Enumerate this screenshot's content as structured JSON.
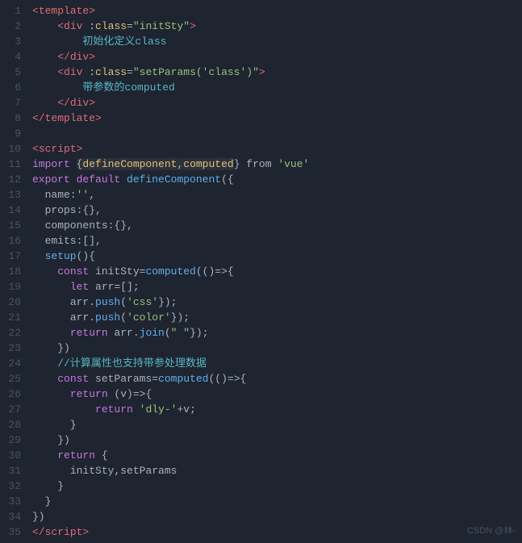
{
  "editor": {
    "lines": [
      {
        "num": 1,
        "tokens": [
          {
            "t": "<",
            "c": "kw-tag"
          },
          {
            "t": "template",
            "c": "kw-tag"
          },
          {
            "t": ">",
            "c": "kw-tag"
          }
        ]
      },
      {
        "num": 2,
        "tokens": [
          {
            "t": "    <",
            "c": "kw-tag"
          },
          {
            "t": "div",
            "c": "kw-tag"
          },
          {
            "t": " ",
            "c": "plain"
          },
          {
            "t": ":class",
            "c": "kw-attr"
          },
          {
            "t": "=",
            "c": "plain"
          },
          {
            "t": "\"initSty\"",
            "c": "kw-attr-val"
          },
          {
            "t": ">",
            "c": "kw-tag"
          }
        ]
      },
      {
        "num": 3,
        "tokens": [
          {
            "t": "        ",
            "c": "plain"
          },
          {
            "t": "初始化定义class",
            "c": "comment-cn"
          }
        ]
      },
      {
        "num": 4,
        "tokens": [
          {
            "t": "    </",
            "c": "kw-tag"
          },
          {
            "t": "div",
            "c": "kw-tag"
          },
          {
            "t": ">",
            "c": "kw-tag"
          }
        ]
      },
      {
        "num": 5,
        "tokens": [
          {
            "t": "    <",
            "c": "kw-tag"
          },
          {
            "t": "div",
            "c": "kw-tag"
          },
          {
            "t": " ",
            "c": "plain"
          },
          {
            "t": ":class",
            "c": "kw-attr"
          },
          {
            "t": "=",
            "c": "plain"
          },
          {
            "t": "\"setParams('class')\"",
            "c": "kw-attr-val"
          },
          {
            "t": ">",
            "c": "kw-tag"
          }
        ]
      },
      {
        "num": 6,
        "tokens": [
          {
            "t": "        ",
            "c": "plain"
          },
          {
            "t": "带参数的computed",
            "c": "comment-cn"
          }
        ]
      },
      {
        "num": 7,
        "tokens": [
          {
            "t": "    </",
            "c": "kw-tag"
          },
          {
            "t": "div",
            "c": "kw-tag"
          },
          {
            "t": ">",
            "c": "kw-tag"
          }
        ]
      },
      {
        "num": 8,
        "tokens": [
          {
            "t": "</",
            "c": "kw-tag"
          },
          {
            "t": "template",
            "c": "kw-tag"
          },
          {
            "t": ">",
            "c": "kw-tag"
          }
        ]
      },
      {
        "num": 9,
        "tokens": []
      },
      {
        "num": 10,
        "tokens": [
          {
            "t": "<",
            "c": "kw-tag"
          },
          {
            "t": "script",
            "c": "kw-tag"
          },
          {
            "t": ">",
            "c": "kw-tag"
          }
        ]
      },
      {
        "num": 11,
        "tokens": [
          {
            "t": "import ",
            "c": "kw-js"
          },
          {
            "t": "{",
            "c": "plain"
          },
          {
            "t": "defineComponent",
            "c": "ident"
          },
          {
            "t": ",",
            "c": "plain"
          },
          {
            "t": "computed",
            "c": "ident"
          },
          {
            "t": "} ",
            "c": "plain"
          },
          {
            "t": "from",
            "c": "plain"
          },
          {
            "t": " ",
            "c": "plain"
          },
          {
            "t": "'vue'",
            "c": "str"
          }
        ]
      },
      {
        "num": 12,
        "tokens": [
          {
            "t": "export ",
            "c": "kw-js"
          },
          {
            "t": "default ",
            "c": "kw-js"
          },
          {
            "t": "defineComponent",
            "c": "ident-blue"
          },
          {
            "t": "({",
            "c": "plain"
          }
        ]
      },
      {
        "num": 13,
        "tokens": [
          {
            "t": "  name:",
            "c": "plain"
          },
          {
            "t": "''",
            "c": "str"
          },
          {
            "t": ",",
            "c": "plain"
          }
        ]
      },
      {
        "num": 14,
        "tokens": [
          {
            "t": "  props:",
            "c": "plain"
          },
          {
            "t": "{}",
            "c": "plain"
          },
          {
            "t": ",",
            "c": "plain"
          }
        ]
      },
      {
        "num": 15,
        "tokens": [
          {
            "t": "  components:",
            "c": "plain"
          },
          {
            "t": "{}",
            "c": "plain"
          },
          {
            "t": ",",
            "c": "plain"
          }
        ]
      },
      {
        "num": 16,
        "tokens": [
          {
            "t": "  emits:",
            "c": "plain"
          },
          {
            "t": "[]",
            "c": "plain"
          },
          {
            "t": ",",
            "c": "plain"
          }
        ]
      },
      {
        "num": 17,
        "tokens": [
          {
            "t": "  setup",
            "c": "ident-blue"
          },
          {
            "t": "()",
            "c": "plain"
          },
          {
            "t": "{",
            "c": "plain"
          }
        ]
      },
      {
        "num": 18,
        "tokens": [
          {
            "t": "    ",
            "c": "plain"
          },
          {
            "t": "const ",
            "c": "kw-js"
          },
          {
            "t": "initSty",
            "c": "plain"
          },
          {
            "t": "=",
            "c": "plain"
          },
          {
            "t": "computed",
            "c": "ident-blue"
          },
          {
            "t": "(()=>",
            "c": "plain"
          },
          {
            "t": "{",
            "c": "plain"
          }
        ]
      },
      {
        "num": 19,
        "tokens": [
          {
            "t": "      ",
            "c": "plain"
          },
          {
            "t": "let ",
            "c": "kw-js"
          },
          {
            "t": "arr",
            "c": "plain"
          },
          {
            "t": "=",
            "c": "plain"
          },
          {
            "t": "[]",
            "c": "plain"
          },
          {
            "t": ";",
            "c": "plain"
          }
        ]
      },
      {
        "num": 20,
        "tokens": [
          {
            "t": "      ",
            "c": "plain"
          },
          {
            "t": "arr",
            "c": "plain"
          },
          {
            "t": ".",
            "c": "plain"
          },
          {
            "t": "push",
            "c": "ident-blue"
          },
          {
            "t": "(",
            "c": "plain"
          },
          {
            "t": "'css'",
            "c": "str"
          },
          {
            "t": "});",
            "c": "plain"
          }
        ]
      },
      {
        "num": 21,
        "tokens": [
          {
            "t": "      ",
            "c": "plain"
          },
          {
            "t": "arr",
            "c": "plain"
          },
          {
            "t": ".",
            "c": "plain"
          },
          {
            "t": "push",
            "c": "ident-blue"
          },
          {
            "t": "(",
            "c": "plain"
          },
          {
            "t": "'color'",
            "c": "str"
          },
          {
            "t": "});",
            "c": "plain"
          }
        ]
      },
      {
        "num": 22,
        "tokens": [
          {
            "t": "      ",
            "c": "plain"
          },
          {
            "t": "return ",
            "c": "kw-js"
          },
          {
            "t": "arr",
            "c": "plain"
          },
          {
            "t": ".",
            "c": "plain"
          },
          {
            "t": "join",
            "c": "ident-blue"
          },
          {
            "t": "(",
            "c": "plain"
          },
          {
            "t": "\" \"",
            "c": "str"
          },
          {
            "t": "});",
            "c": "plain"
          }
        ]
      },
      {
        "num": 23,
        "tokens": [
          {
            "t": "    })",
            "c": "plain"
          }
        ]
      },
      {
        "num": 24,
        "tokens": [
          {
            "t": "    ",
            "c": "plain"
          },
          {
            "t": "//计算属性也支持带参处理数据",
            "c": "comment-cn"
          }
        ]
      },
      {
        "num": 25,
        "tokens": [
          {
            "t": "    ",
            "c": "plain"
          },
          {
            "t": "const ",
            "c": "kw-js"
          },
          {
            "t": "setParams",
            "c": "plain"
          },
          {
            "t": "=",
            "c": "plain"
          },
          {
            "t": "computed",
            "c": "ident-blue"
          },
          {
            "t": "(()=>",
            "c": "plain"
          },
          {
            "t": "{",
            "c": "plain"
          }
        ]
      },
      {
        "num": 26,
        "tokens": [
          {
            "t": "      ",
            "c": "plain"
          },
          {
            "t": "return ",
            "c": "kw-js"
          },
          {
            "t": "(v)=>",
            "c": "plain"
          },
          {
            "t": "{",
            "c": "plain"
          }
        ]
      },
      {
        "num": 27,
        "tokens": [
          {
            "t": "        ",
            "c": "plain"
          },
          {
            "t": "  ",
            "c": "plain"
          },
          {
            "t": "return ",
            "c": "kw-js"
          },
          {
            "t": "'dly-'",
            "c": "str"
          },
          {
            "t": "+",
            "c": "plain"
          },
          {
            "t": "v",
            "c": "plain"
          },
          {
            "t": ";",
            "c": "plain"
          }
        ]
      },
      {
        "num": 28,
        "tokens": [
          {
            "t": "      }",
            "c": "plain"
          }
        ]
      },
      {
        "num": 29,
        "tokens": [
          {
            "t": "    })",
            "c": "plain"
          }
        ]
      },
      {
        "num": 30,
        "tokens": [
          {
            "t": "    ",
            "c": "plain"
          },
          {
            "t": "return ",
            "c": "kw-js"
          },
          {
            "t": "{",
            "c": "plain"
          }
        ]
      },
      {
        "num": 31,
        "tokens": [
          {
            "t": "      ",
            "c": "plain"
          },
          {
            "t": "initSty",
            "c": "plain"
          },
          {
            "t": ",",
            "c": "plain"
          },
          {
            "t": "setParams",
            "c": "plain"
          }
        ]
      },
      {
        "num": 32,
        "tokens": [
          {
            "t": "    }",
            "c": "plain"
          }
        ]
      },
      {
        "num": 33,
        "tokens": [
          {
            "t": "  }",
            "c": "plain"
          }
        ]
      },
      {
        "num": 34,
        "tokens": [
          {
            "t": "})",
            "c": "plain"
          }
        ]
      },
      {
        "num": 35,
        "tokens": [
          {
            "t": "</",
            "c": "kw-tag"
          },
          {
            "t": "script",
            "c": "kw-tag"
          },
          {
            "t": ">",
            "c": "kw-tag"
          }
        ]
      }
    ],
    "watermark": "CSDN @林-"
  }
}
